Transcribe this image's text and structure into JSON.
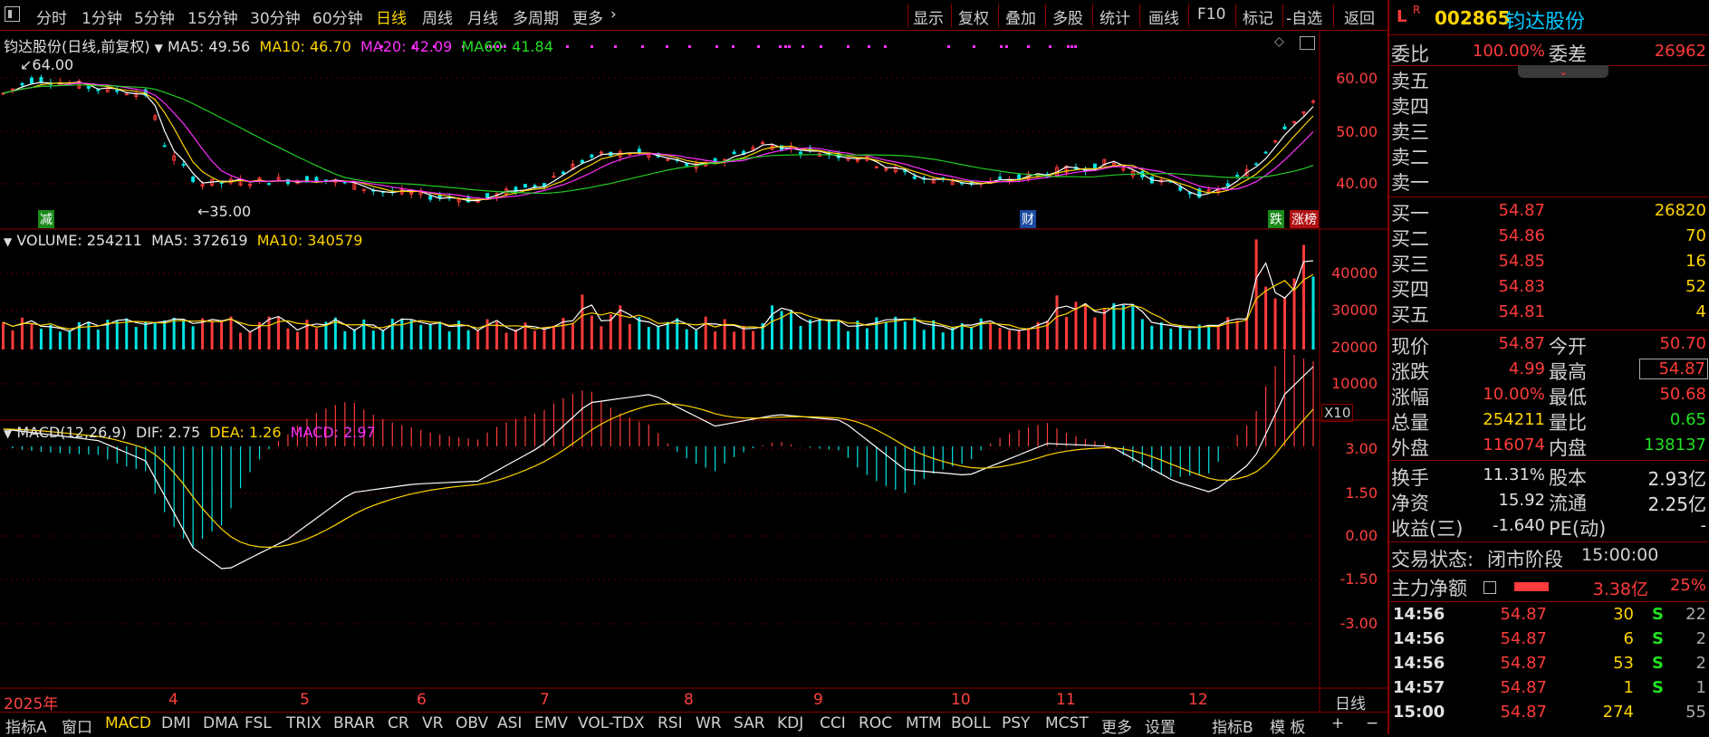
{
  "toolbar": {
    "periods": [
      "分时",
      "1分钟",
      "5分钟",
      "15分钟",
      "30分钟",
      "60分钟",
      "日线",
      "周线",
      "月线",
      "多周期",
      "更多"
    ],
    "active_period": "日线",
    "right_buttons": [
      "显示",
      "复权",
      "叠加",
      "多股",
      "统计",
      "画线",
      "F10",
      "标记",
      "-自选",
      "返回"
    ]
  },
  "main_chart": {
    "legend": {
      "title": "钧达股份(日线,前复权)",
      "ma5": "MA5: 49.56",
      "ma10": "MA10: 46.70",
      "ma20": "MA20: 42.09",
      "ma60": "MA60: 41.84"
    },
    "high_label": "64.00",
    "low_label": "35.00",
    "y_ticks": [
      "60.00",
      "50.00",
      "40.00"
    ],
    "markers": {
      "jian": "减",
      "cai": "财",
      "die": "跌",
      "zhangting": "涨榜"
    }
  },
  "volume_chart": {
    "legend": {
      "volume": "VOLUME: 254211",
      "ma5": "MA5: 372619",
      "ma10": "MA10: 340579"
    },
    "y_ticks": [
      "40000",
      "30000",
      "20000",
      "10000"
    ],
    "unit": "X10"
  },
  "macd_chart": {
    "legend": {
      "title": "MACD(12,26,9)",
      "dif": "DIF: 2.75",
      "dea": "DEA: 1.26",
      "macd": "MACD: 2.97"
    },
    "y_ticks": [
      "3.00",
      "1.50",
      "0.00",
      "-1.50",
      "-3.00"
    ]
  },
  "time_axis": {
    "labels": [
      "2025年",
      "4",
      "5",
      "6",
      "7",
      "8",
      "9",
      "10",
      "11",
      "12"
    ],
    "period_label": "日线"
  },
  "indicator_tabs": [
    "指标A",
    "窗口",
    "MACD",
    "DMI",
    "DMA",
    "FSL",
    "TRIX",
    "BRAR",
    "CR",
    "VR",
    "OBV",
    "ASI",
    "EMV",
    "VOL-TDX",
    "RSI",
    "WR",
    "SAR",
    "KDJ",
    "CCI",
    "ROC",
    "MTM",
    "BOLL",
    "PSY",
    "MCST",
    "更多",
    "设置",
    "指标B",
    "模 板",
    "+",
    "−"
  ],
  "active_indicator": "MACD",
  "quote": {
    "code": "002865",
    "name": "钧达股份",
    "badge_l": "L",
    "badge_r": "R",
    "weibi_label": "委比",
    "weibi": "100.00%",
    "weicha_label": "委差",
    "weicha": "26962",
    "asks": [
      {
        "label": "卖五",
        "price": "",
        "vol": ""
      },
      {
        "label": "卖四",
        "price": "",
        "vol": ""
      },
      {
        "label": "卖三",
        "price": "",
        "vol": ""
      },
      {
        "label": "卖二",
        "price": "",
        "vol": ""
      },
      {
        "label": "卖一",
        "price": "",
        "vol": ""
      }
    ],
    "bids": [
      {
        "label": "买一",
        "price": "54.87",
        "vol": "26820"
      },
      {
        "label": "买二",
        "price": "54.86",
        "vol": "70"
      },
      {
        "label": "买三",
        "price": "54.85",
        "vol": "16"
      },
      {
        "label": "买四",
        "price": "54.83",
        "vol": "52"
      },
      {
        "label": "买五",
        "price": "54.81",
        "vol": "4"
      }
    ],
    "stats": [
      {
        "l1": "现价",
        "v1": "54.87",
        "l2": "今开",
        "v2": "50.70"
      },
      {
        "l1": "涨跌",
        "v1": "4.99",
        "l2": "最高",
        "v2": "54.87"
      },
      {
        "l1": "涨幅",
        "v1": "10.00%",
        "l2": "最低",
        "v2": "50.68"
      },
      {
        "l1": "总量",
        "v1": "254211",
        "l2": "量比",
        "v2": "0.65"
      },
      {
        "l1": "外盘",
        "v1": "116074",
        "l2": "内盘",
        "v2": "138137"
      }
    ],
    "fund": [
      {
        "l1": "换手",
        "v1": "11.31%",
        "l2": "股本",
        "v2": "2.93亿"
      },
      {
        "l1": "净资",
        "v1": "15.92",
        "l2": "流通",
        "v2": "2.25亿"
      },
      {
        "l1": "收益(三)",
        "v1": "-1.640",
        "l2": "PE(动)",
        "v2": "-"
      }
    ],
    "trade_status_label": "交易状态:",
    "trade_status": "闭市阶段",
    "trade_time": "15:00:00",
    "main_flow_label": "主力净额",
    "main_flow_value": "3.38亿",
    "main_flow_pct": "25%",
    "ticks": [
      {
        "time": "14:56",
        "price": "54.87",
        "vol": "30",
        "side": "S",
        "count": "22"
      },
      {
        "time": "14:56",
        "price": "54.87",
        "vol": "6",
        "side": "S",
        "count": "2"
      },
      {
        "time": "14:56",
        "price": "54.87",
        "vol": "53",
        "side": "S",
        "count": "2"
      },
      {
        "time": "14:57",
        "price": "54.87",
        "vol": "1",
        "side": "S",
        "count": "1"
      },
      {
        "time": "15:00",
        "price": "54.87",
        "vol": "274",
        "side": "",
        "count": "55"
      }
    ]
  },
  "colors": {
    "up": "#ff3b3b",
    "down": "#00e5e5",
    "grid": "#8a0000",
    "ma5": "#ffffff",
    "ma10": "#ffd400",
    "ma20": "#ff30ff",
    "ma60": "#22cc22"
  }
}
